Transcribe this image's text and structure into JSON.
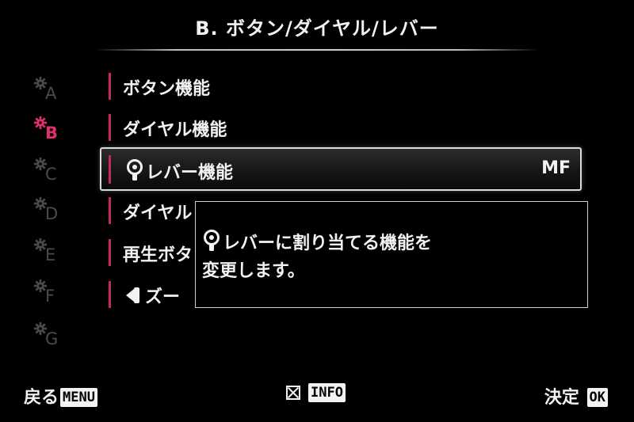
{
  "header": {
    "title": "B. ボタン/ダイヤル/レバー"
  },
  "tabs": [
    {
      "letter": "A",
      "active": false
    },
    {
      "letter": "B",
      "active": true
    },
    {
      "letter": "C",
      "active": false
    },
    {
      "letter": "D",
      "active": false
    },
    {
      "letter": "E",
      "active": false
    },
    {
      "letter": "F",
      "active": false
    },
    {
      "letter": "G",
      "active": false
    }
  ],
  "menu": {
    "items": [
      {
        "label": "ボタン機能"
      },
      {
        "label": "ダイヤル機能"
      },
      {
        "label": "レバー機能",
        "value": "MF",
        "icon": "lever-icon",
        "selected": true
      },
      {
        "label": "ダイヤル"
      },
      {
        "label": "再生ボタ"
      },
      {
        "label": "ズー",
        "icon": "zoom-lever-icon"
      }
    ]
  },
  "info_box": {
    "line1": "レバーに割り当てる機能を",
    "line2": "変更します。",
    "icon": "lever-icon"
  },
  "footer": {
    "back_label": "戻る",
    "back_key": "MENU",
    "info_key": "INFO",
    "confirm_label": "決定",
    "confirm_key": "OK"
  },
  "colors": {
    "accent": "#e0306e",
    "bar": "#c52a5d",
    "inactive_tab": "#4a4a4a"
  }
}
